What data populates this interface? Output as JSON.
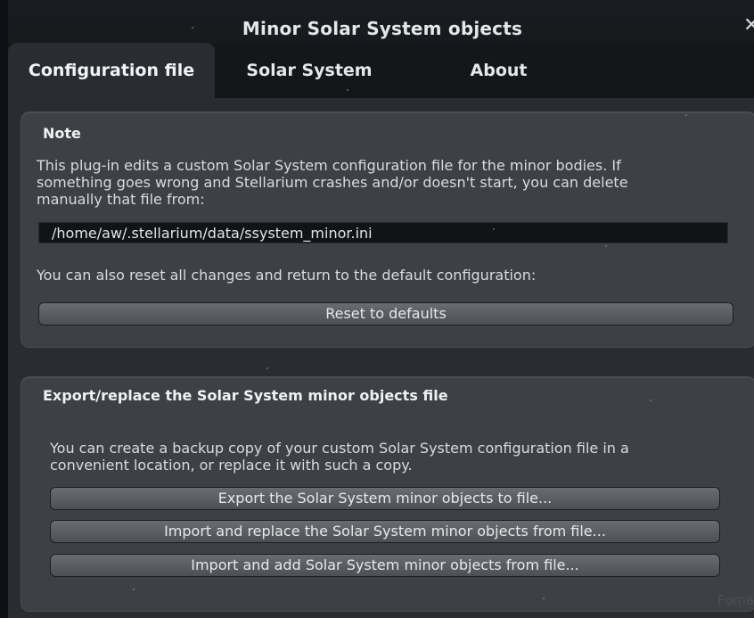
{
  "window": {
    "title": "Minor Solar System objects",
    "close_glyph": "✕"
  },
  "tabs": [
    {
      "label": "Configuration file",
      "active": true
    },
    {
      "label": "Solar System",
      "active": false
    },
    {
      "label": "About",
      "active": false
    }
  ],
  "note_panel": {
    "title": "Note",
    "description_lines": [
      "This plug-in edits a custom Solar System configuration file for the minor bodies. If",
      "something goes wrong and Stellarium crashes and/or doesn't start, you can delete",
      "manually that file from:"
    ],
    "path": "/home/aw/.stellarium/data/ssystem_minor.ini",
    "reset_text": "You can also reset all changes and return to the default configuration:",
    "reset_button": "Reset to defaults"
  },
  "export_panel": {
    "title": "Export/replace the Solar System minor objects file",
    "description_lines": [
      "You can create a backup copy of your custom Solar System configuration file in a",
      "convenient location, or replace it with such a copy."
    ],
    "buttons": [
      "Export the Solar System minor objects to file...",
      "Import and replace the Solar System minor objects from file...",
      "Import and add Solar System minor objects from file..."
    ]
  },
  "background_corner_text": "Foma"
}
